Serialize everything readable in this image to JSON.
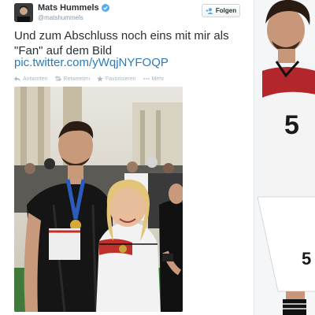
{
  "tweet": {
    "display_name": "Mats Hummels",
    "handle": "@matshummels",
    "verified": true,
    "text": "Und zum Abschluss noch eins mit mir als \"Fan\" auf dem Bild",
    "link": "pic.twitter.com/yWqjNYFOQP",
    "follow_label": "Folgen",
    "actions": {
      "reply": "Antworten",
      "retweet": "Retweeten",
      "favorite": "Favorisieren",
      "more": "Mehr"
    },
    "jersey_number": "5"
  },
  "colors": {
    "link": "#2b7bb9",
    "verified": "#55acee",
    "text": "#292f33",
    "muted": "#8899a6"
  }
}
